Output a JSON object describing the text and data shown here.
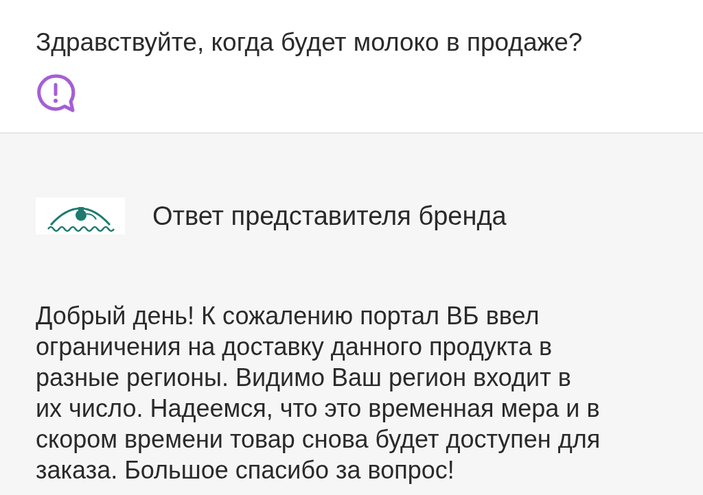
{
  "question": {
    "text": "Здравствуйте, когда будет молоко в продаже?"
  },
  "answer": {
    "title": "Ответ представителя бренда",
    "text": "Добрый день! К сожалению портал ВБ ввел ограничения на доставку данного продукта в разные регионы. Видимо Ваш регион входит в их число. Надеемся, что это временная мера и в скором времени товар снова будет доступен для заказа. Большое спасибо за вопрос!"
  }
}
